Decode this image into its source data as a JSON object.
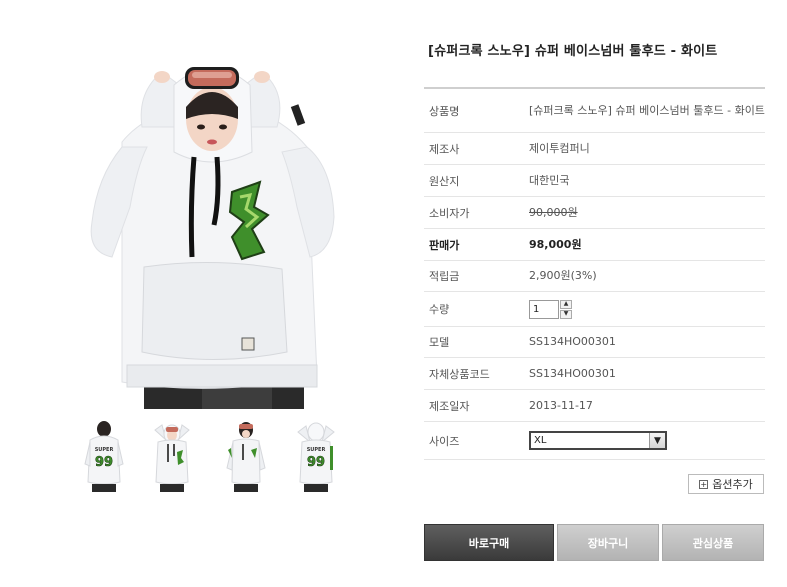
{
  "product": {
    "title": "[슈퍼크록 스노우] 슈퍼 베이스넘버 툴후드 - 화이트"
  },
  "specs": [
    {
      "label": "상품명",
      "value": "[슈퍼크록 스노우] 슈퍼 베이스넘버 툴후드 - 화이트"
    },
    {
      "label": "제조사",
      "value": "제이투컴퍼니"
    },
    {
      "label": "원산지",
      "value": "대한민국"
    },
    {
      "label": "소비자가",
      "value": "90,000원"
    },
    {
      "label": "판매가",
      "value": "98,000원"
    },
    {
      "label": "적립금",
      "value": "2,900원(3%)"
    },
    {
      "label": "수량",
      "value": "1"
    },
    {
      "label": "모델",
      "value": "SS134HO00301"
    },
    {
      "label": "자체상품코드",
      "value": "SS134HO00301"
    },
    {
      "label": "제조일자",
      "value": "2013-11-17"
    },
    {
      "label": "사이즈",
      "value": "XL"
    }
  ],
  "thumbnails": [
    {
      "number": "99",
      "brand": "SUPER"
    },
    {
      "number": "",
      "brand": ""
    },
    {
      "number": "",
      "brand": ""
    },
    {
      "number": "99",
      "brand": "SUPER"
    }
  ],
  "actions": {
    "option_add": "옵션추가",
    "buy": "바로구매",
    "cart": "장바구니",
    "wish": "관심상품"
  },
  "colors": {
    "hoodie": "#f4f5f7",
    "graphic_green": "#3f8f2b",
    "buy_button": "#474747",
    "secondary_button": "#c2c2c2"
  }
}
